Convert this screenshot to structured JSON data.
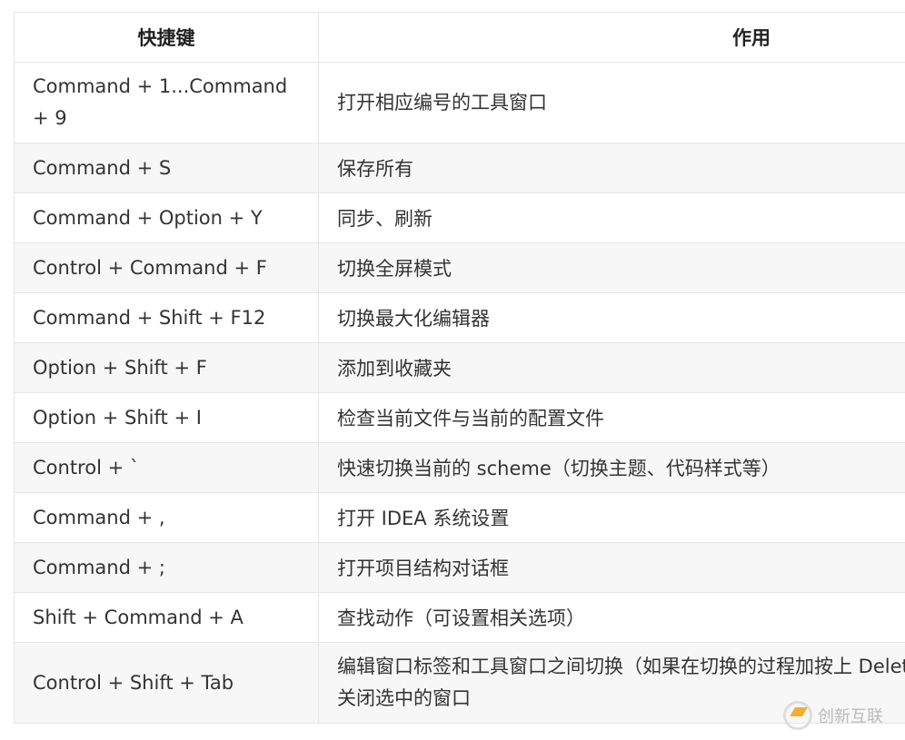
{
  "header": {
    "col1": "快捷键",
    "col2": "作用"
  },
  "rows": [
    {
      "key": "Command + 1...Command + 9",
      "desc": "打开相应编号的工具窗口"
    },
    {
      "key": "Command + S",
      "desc": "保存所有"
    },
    {
      "key": "Command + Option + Y",
      "desc": "同步、刷新"
    },
    {
      "key": "Control + Command + F",
      "desc": "切换全屏模式"
    },
    {
      "key": "Command + Shift + F12",
      "desc": "切换最大化编辑器"
    },
    {
      "key": "Option + Shift + F",
      "desc": "添加到收藏夹"
    },
    {
      "key": "Option + Shift + I",
      "desc": "检查当前文件与当前的配置文件"
    },
    {
      "key": "Control + `",
      "desc": "快速切换当前的 scheme（切换主题、代码样式等）"
    },
    {
      "key": "Command + ,",
      "desc": "打开 IDEA 系统设置"
    },
    {
      "key": "Command + ;",
      "desc": "打开项目结构对话框"
    },
    {
      "key": "Shift + Command + A",
      "desc": "查找动作（可设置相关选项）"
    },
    {
      "key": "Control + Shift + Tab",
      "desc": "编辑窗口标签和工具窗口之间切换（如果在切换的过程加按上 Delete，则是关闭选中的窗口"
    }
  ],
  "watermark": "创新互联"
}
